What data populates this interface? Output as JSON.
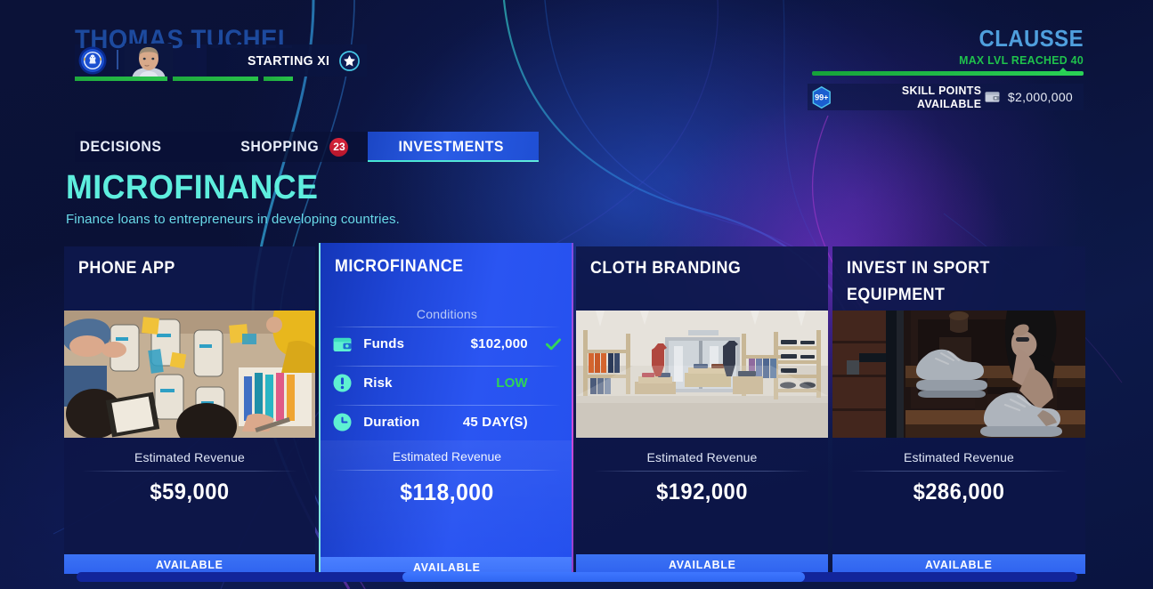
{
  "header": {
    "coach_name": "THOMAS TUCHEL",
    "club_crest_icon": "chelsea-crest-icon",
    "coach_portrait_icon": "coach-portrait",
    "squad_label": "STARTING XI",
    "squad_star_icon": "star-icon",
    "level_name": "CLAUSSE",
    "level_sub": "MAX LVL REACHED 40",
    "skill_badge": "99+",
    "skill_label": "SKILL POINTS AVAILABLE",
    "wallet_icon": "wallet-icon",
    "money": "$2,000,000"
  },
  "tabs": [
    {
      "label": "DECISIONS",
      "badge": null,
      "active": false
    },
    {
      "label": "SHOPPING",
      "badge": "23",
      "active": false
    },
    {
      "label": "INVESTMENTS",
      "badge": null,
      "active": true
    }
  ],
  "page": {
    "title": "MICROFINANCE",
    "subtitle": "Finance loans to entrepreneurs in developing countries."
  },
  "labels": {
    "estimated_revenue": "Estimated Revenue",
    "conditions": "Conditions",
    "available": "AVAILABLE"
  },
  "selected_card": {
    "title": "MICROFINANCE",
    "conditions_title": "Conditions",
    "conditions": [
      {
        "icon": "wallet-icon",
        "name": "Funds",
        "value": "$102,000",
        "check": true
      },
      {
        "icon": "risk-icon",
        "name": "Risk",
        "value": "LOW",
        "check": false,
        "value_color": "green"
      },
      {
        "icon": "clock-icon",
        "name": "Duration",
        "value": "45 DAY(S)",
        "check": false
      }
    ],
    "revenue_label": "Estimated Revenue",
    "revenue_value": "$118,000",
    "status": "AVAILABLE"
  },
  "cards": [
    {
      "title": "PHONE APP",
      "revenue_label": "Estimated Revenue",
      "revenue_value": "$59,000",
      "status": "AVAILABLE",
      "photo": "ux-design-workshop-photo"
    },
    {
      "title": "CLOTH BRANDING",
      "revenue_label": "Estimated Revenue",
      "revenue_value": "$192,000",
      "status": "AVAILABLE",
      "photo": "clothing-store-interior-photo"
    },
    {
      "title": "INVEST IN SPORT EQUIPMENT",
      "revenue_label": "Estimated Revenue",
      "revenue_value": "$286,000",
      "status": "AVAILABLE",
      "photo": "sneakers-on-steps-photo"
    }
  ],
  "colors": {
    "accent_cyan": "#5eeede",
    "accent_blue": "#2a5ce6",
    "green": "#2fd457",
    "red_badge": "#d9243a",
    "page_bg": "#0b1238"
  },
  "scrollbar": {
    "name": "horizontal-scrollbar"
  }
}
